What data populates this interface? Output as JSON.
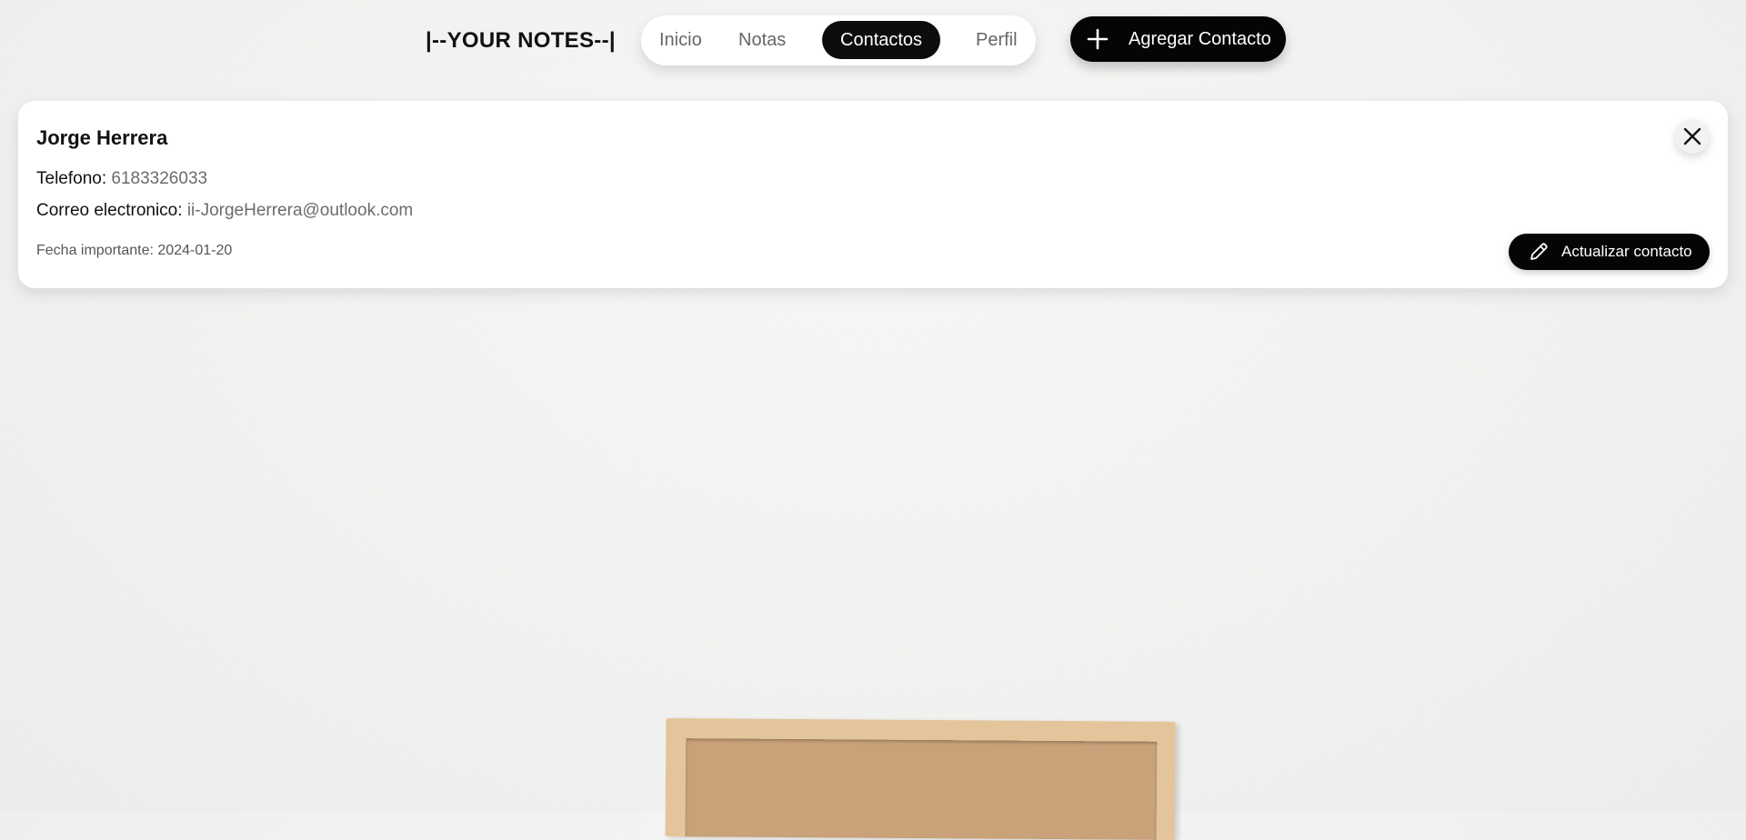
{
  "brand": "|--YOUR NOTES--|",
  "nav": {
    "items": [
      {
        "label": "Inicio",
        "active": false
      },
      {
        "label": "Notas",
        "active": false
      },
      {
        "label": "Contactos",
        "active": true
      },
      {
        "label": "Perfil",
        "active": false
      }
    ]
  },
  "add_button": {
    "icon": "plus-icon",
    "label": "Agregar Contacto"
  },
  "contact": {
    "name": "Jorge Herrera",
    "phone_label": "Telefono:",
    "phone": "6183326033",
    "email_label": "Correo electronico:",
    "email": "ii-JorgeHerrera@outlook.com",
    "date_label": "Fecha importante:",
    "date": "2024-01-20",
    "close_icon": "close-icon",
    "update_icon": "pencil-icon",
    "update_label": "Actualizar contacto"
  },
  "colors": {
    "accent": "#050505",
    "muted_text": "#6b6b6b",
    "card_bg": "#ffffff"
  }
}
